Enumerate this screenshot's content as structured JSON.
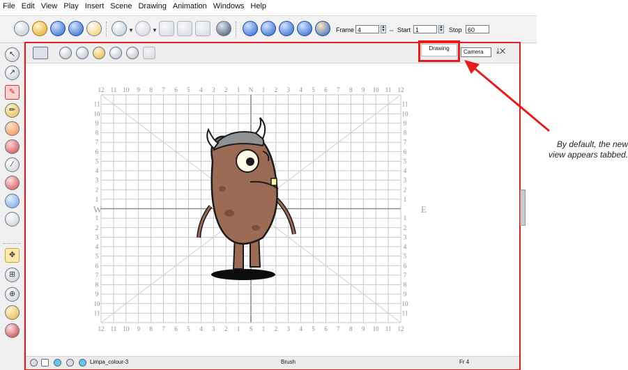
{
  "menu": [
    "File",
    "Edit",
    "View",
    "Play",
    "Insert",
    "Scene",
    "Drawing",
    "Animation",
    "Windows",
    "Help"
  ],
  "toolbar": {
    "icons": [
      "new-scene-icon",
      "open-icon",
      "save-icon",
      "save-as-icon",
      "import-icon",
      "undo-icon",
      "redo-icon",
      "cut-icon",
      "copy-icon",
      "paste-icon",
      "render-icon",
      "play-icon",
      "loop-icon",
      "sound-icon",
      "sound-scrub-icon",
      "playback-icon"
    ],
    "frame_label": "Frame",
    "frame_value": "4",
    "start_label": "Start",
    "start_value": "1",
    "stop_label": "Stop",
    "stop_value": "60"
  },
  "palette": {
    "tools": [
      "select-icon",
      "contour-editor-icon",
      "brush-icon",
      "pencil-icon",
      "eraser-icon",
      "paint-icon",
      "line-icon",
      "dropper-icon",
      "stroke-icon",
      "close-gap-icon",
      "transform-icon",
      "grid-icon",
      "pivot-icon",
      "color-icon",
      "morph-icon"
    ]
  },
  "view": {
    "tabs": [
      {
        "label": "Drawing",
        "active": true
      },
      {
        "label": "Camera",
        "active": false
      }
    ],
    "grid": {
      "top_numbers": [
        "12",
        "11",
        "10",
        "9",
        "8",
        "7",
        "6",
        "5",
        "4",
        "3",
        "2",
        "1",
        "N",
        "1",
        "2",
        "3",
        "4",
        "5",
        "6",
        "7",
        "8",
        "9",
        "10",
        "11",
        "12"
      ],
      "bottom_numbers": [
        "12",
        "11",
        "10",
        "9",
        "8",
        "7",
        "6",
        "5",
        "4",
        "3",
        "2",
        "1",
        "S",
        "1",
        "2",
        "3",
        "4",
        "5",
        "6",
        "7",
        "8",
        "9",
        "10",
        "11",
        "12"
      ],
      "side_numbers": [
        "11",
        "10",
        "9",
        "8",
        "7",
        "6",
        "5",
        "4",
        "3",
        "2",
        "1",
        "1",
        "2",
        "3",
        "4",
        "5",
        "6",
        "7",
        "8",
        "9",
        "10",
        "11"
      ],
      "west": "W",
      "east": "E"
    },
    "status": {
      "drawing": "Limpa_colour-3",
      "tool": "Brush",
      "frame": "Fr 4"
    }
  },
  "annotation": {
    "line1": "By default, the new",
    "line2": "view appears tabbed."
  },
  "colors": {
    "highlight": "#e41c1c",
    "arrow": "#e41c1c",
    "grid": "#b9b9b9",
    "character_body": "#9b6b55",
    "helmet": "#8f9294"
  }
}
